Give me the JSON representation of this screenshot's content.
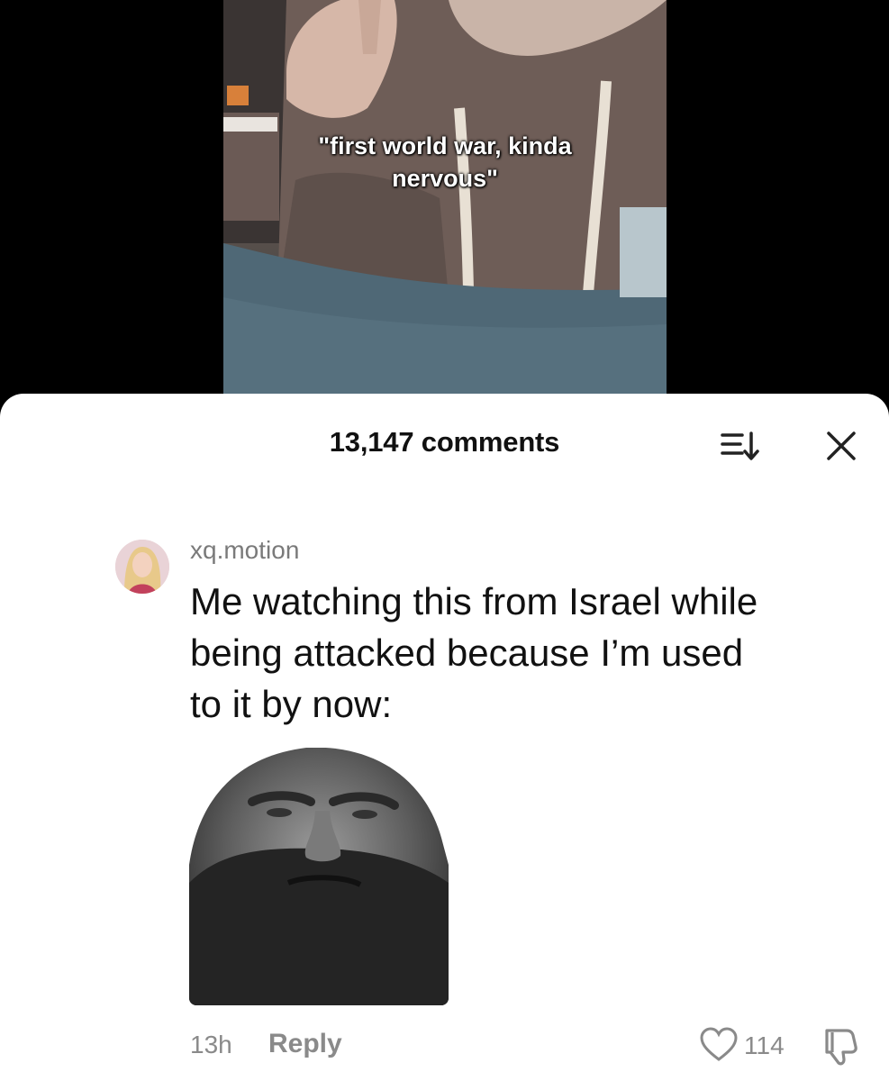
{
  "video": {
    "caption_line1": "\"first world war, kinda",
    "caption_line2": "nervous\""
  },
  "comments_panel": {
    "title": "13,147 comments",
    "sort_icon": "sort-descending-icon",
    "close_icon": "close-icon"
  },
  "comment": {
    "username": "xq.motion",
    "text_line1": "Me watching this from Israel while",
    "text_line2": "being attacked because I’m used",
    "text_line3": "to it by now:",
    "time": "13h",
    "reply_label": "Reply",
    "like_count": "114",
    "like_icon": "heart-outline-icon",
    "dislike_icon": "thumbs-down-icon"
  },
  "colors": {
    "sheet_background": "#ffffff",
    "muted_text": "#8a8a8a",
    "primary_text": "#111111"
  }
}
